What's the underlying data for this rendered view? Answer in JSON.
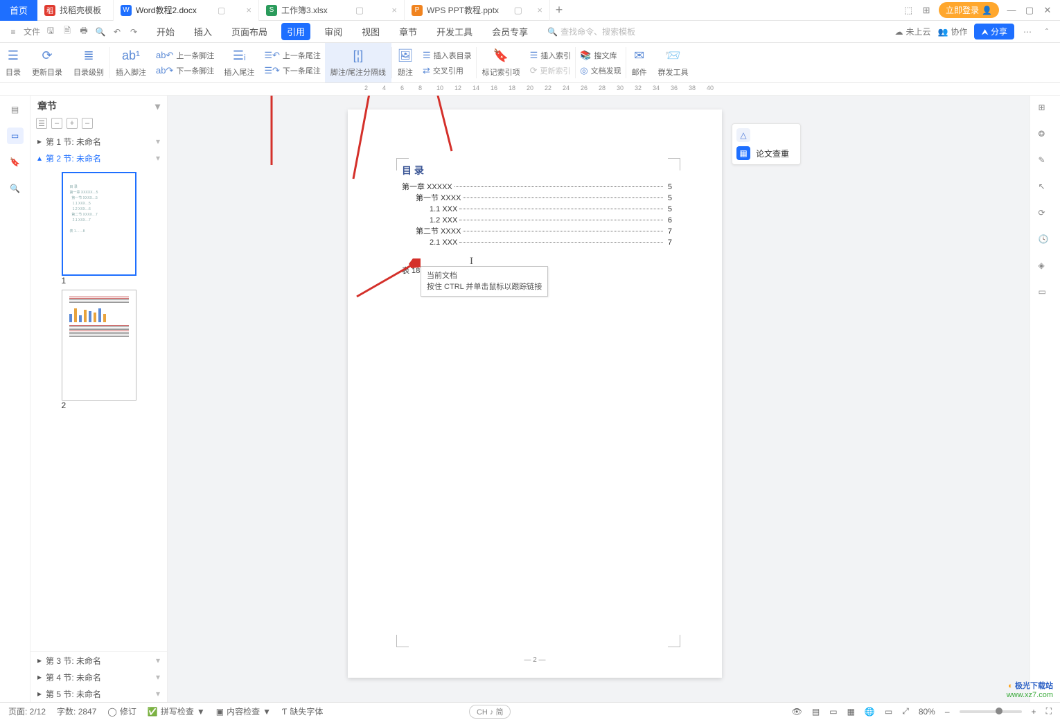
{
  "tabs": {
    "home": "首页",
    "files": [
      {
        "icon": "稻",
        "iconbg": "#e03a2f",
        "name": "找稻壳模板"
      },
      {
        "icon": "W",
        "iconbg": "#1e6fff",
        "name": "Word教程2.docx",
        "active": true
      },
      {
        "icon": "S",
        "iconbg": "#2a9b5b",
        "name": "工作簿3.xlsx"
      },
      {
        "icon": "P",
        "iconbg": "#f0831f",
        "name": "WPS PPT教程.pptx"
      }
    ],
    "login": "立即登录"
  },
  "menu": {
    "file": "文件",
    "items": [
      "开始",
      "插入",
      "页面布局",
      "引用",
      "审阅",
      "视图",
      "章节",
      "开发工具",
      "会员专享"
    ],
    "active": "引用",
    "search_placeholder": "查找命令、搜索模板",
    "cloud": "未上云",
    "collab": "协作",
    "share": "分享"
  },
  "ribbon": {
    "g1": [
      "目录",
      "更新目录",
      "目录级别"
    ],
    "g2": {
      "big": "插入脚注",
      "rows": [
        "上一条脚注",
        "下一条脚注"
      ]
    },
    "g3": {
      "big": "插入尾注",
      "rows": [
        "上一条尾注",
        "下一条尾注"
      ]
    },
    "g4": "脚注/尾注分隔线",
    "g5": [
      "题注",
      "交叉引用"
    ],
    "g5row": "插入表目录",
    "g6": "标记索引项",
    "g6rows": [
      "插入索引",
      "更新索引"
    ],
    "g7rows": [
      "搜文库",
      "文档发现"
    ],
    "g8": [
      "邮件",
      "群发工具"
    ]
  },
  "nav": {
    "title": "章节",
    "items": [
      {
        "label": "第 1 节: 未命名",
        "sel": false
      },
      {
        "label": "第 2 节: 未命名",
        "sel": true
      }
    ],
    "bottom": [
      "第 3 节: 未命名",
      "第 4 节: 未命名",
      "第 5 节: 未命名"
    ],
    "thumb_nums": [
      "1",
      "2"
    ]
  },
  "doc": {
    "toc_title": "目 录",
    "toc": [
      {
        "txt": "第一章  XXXXX",
        "ind": 0,
        "pg": "5"
      },
      {
        "txt": "第一节  XXXX",
        "ind": 1,
        "pg": "5"
      },
      {
        "txt": "1.1 XXX",
        "ind": 2,
        "pg": "5"
      },
      {
        "txt": "1.2 XXX",
        "ind": 2,
        "pg": "6"
      },
      {
        "txt": "第二节  XXXX",
        "ind": 1,
        "pg": "7"
      },
      {
        "txt": "2.1 XXX",
        "ind": 2,
        "pg": "7"
      }
    ],
    "table_entry": {
      "label": "表 1",
      "pg": "8"
    },
    "tooltip": {
      "l1": "当前文档",
      "l2": "按住 CTRL 并单击鼠标以跟踪链接"
    },
    "page_number": "— 2 —"
  },
  "sidecard": {
    "label": "论文查重"
  },
  "status": {
    "page": "页面: 2/12",
    "words": "字数: 2847",
    "revise": "修订",
    "spell": "拼写检查",
    "content": "内容检查",
    "missfont": "缺失字体",
    "ime": "CH ♪ 简",
    "zoom": "80%"
  },
  "ruler_ticks": [
    "2",
    "4",
    "6",
    "8",
    "10",
    "12",
    "14",
    "16",
    "18",
    "20",
    "22",
    "24",
    "26",
    "28",
    "30",
    "32",
    "34",
    "36",
    "38",
    "40"
  ],
  "watermark": {
    "l1": "极光下载站",
    "l2": "www.xz7.com"
  }
}
